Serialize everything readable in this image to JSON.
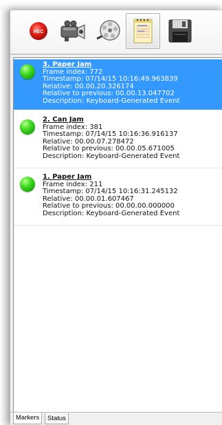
{
  "toolbar": {
    "buttons": [
      {
        "name": "record",
        "icon": "record-icon",
        "label": "REC"
      },
      {
        "name": "camera",
        "icon": "video-camera-icon"
      },
      {
        "name": "film",
        "icon": "film-reel-icon"
      },
      {
        "name": "markers",
        "icon": "notepad-icon",
        "active": true
      },
      {
        "name": "save",
        "icon": "floppy-disk-icon"
      }
    ]
  },
  "markers": [
    {
      "title": "3. Paper Jam",
      "frame_index": "Frame index: 772",
      "timestamp": "Timestamp: 07/14/15 10:16:49.963839",
      "relative": "Relative: 00.00.20.326174",
      "relative_previous": "Relative to previous: 00.00.13.047702",
      "description": "Description: Keyboard-Generated Event",
      "selected": true,
      "status_color": "#22cc11"
    },
    {
      "title": "2. Can Jam",
      "frame_index": "Frame index: 381",
      "timestamp": "Timestamp: 07/14/15 10:16:36.916137",
      "relative": "Relative: 00.00.07.278472",
      "relative_previous": "Relative to previous: 00.00.05.671005",
      "description": "Description: Keyboard-Generated Event",
      "selected": false,
      "status_color": "#22cc11"
    },
    {
      "title": "1. Paper Jam",
      "frame_index": "Frame index: 211",
      "timestamp": "Timestamp: 07/14/15 10:16:31.245132",
      "relative": "Relative: 00.00.01.607467",
      "relative_previous": "Relative to previous: 00.00.00.000000",
      "description": "Description: Keyboard-Generated Event",
      "selected": false,
      "status_color": "#22cc11"
    }
  ],
  "tabs": [
    {
      "label": "Markers",
      "active": true
    },
    {
      "label": "Status",
      "active": false
    }
  ],
  "colors": {
    "selection": "#3399ff",
    "record": "#e02020"
  }
}
